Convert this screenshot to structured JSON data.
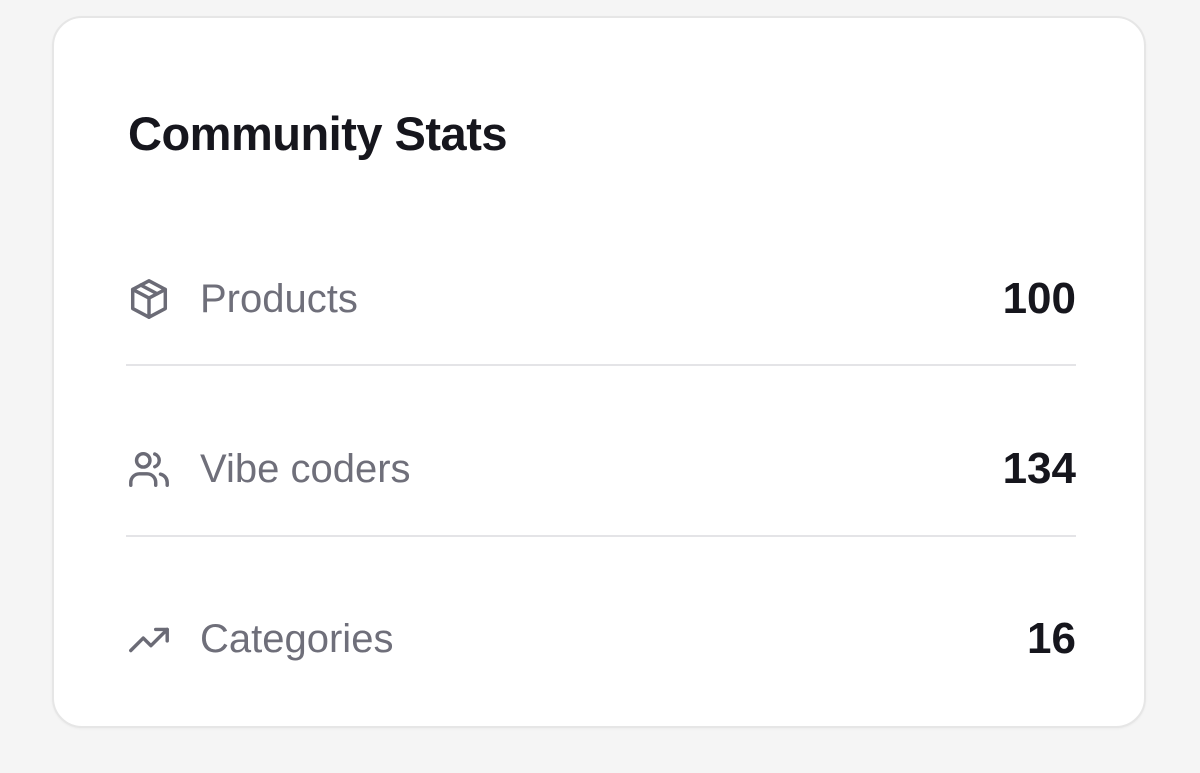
{
  "card": {
    "title": "Community Stats",
    "stats": [
      {
        "icon": "package-icon",
        "label": "Products",
        "value": "100"
      },
      {
        "icon": "users-icon",
        "label": "Vibe coders",
        "value": "134"
      },
      {
        "icon": "trending-up-icon",
        "label": "Categories",
        "value": "16"
      }
    ]
  },
  "colors": {
    "page_background": "#f5f5f5",
    "card_background": "#ffffff",
    "card_border": "#e6e6e6",
    "title_text": "#16161d",
    "label_text": "#6f6f7a",
    "icon_stroke": "#6b6b76",
    "divider": "#e4e4e7"
  }
}
